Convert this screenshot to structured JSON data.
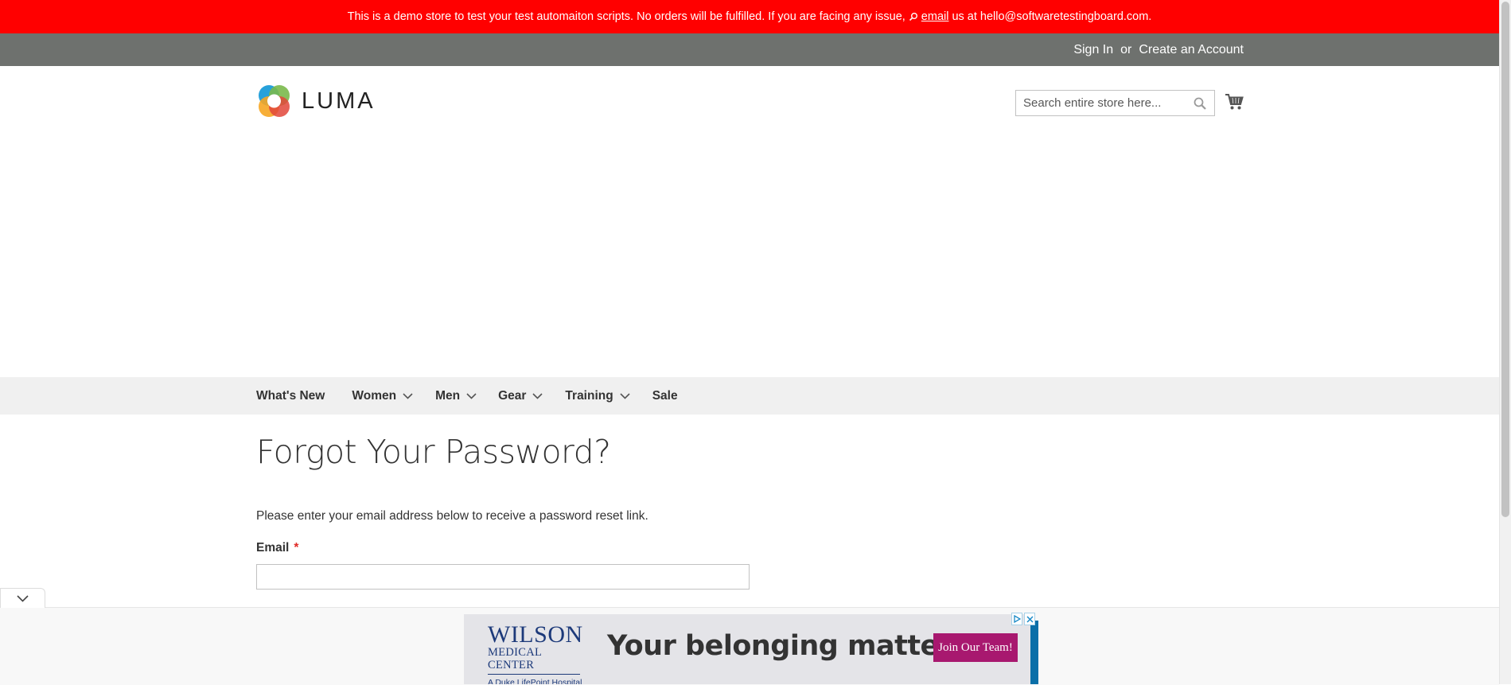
{
  "notice": {
    "text_before": "This is a demo store to test your test automaiton scripts. No orders will be fulfilled. If you are facing any issue,",
    "link": "email",
    "text_after": "us at hello@softwaretestingboard.com."
  },
  "top_links": {
    "sign_in": "Sign In",
    "separator": "or",
    "create_account": "Create an Account"
  },
  "logo": {
    "text": "LUMA"
  },
  "search": {
    "placeholder": "Search entire store here...",
    "value": ""
  },
  "nav": [
    {
      "label": "What's New",
      "has_submenu": false
    },
    {
      "label": "Women",
      "has_submenu": true
    },
    {
      "label": "Men",
      "has_submenu": true
    },
    {
      "label": "Gear",
      "has_submenu": true
    },
    {
      "label": "Training",
      "has_submenu": true
    },
    {
      "label": "Sale",
      "has_submenu": false
    }
  ],
  "main": {
    "title": "Forgot Your Password?",
    "description": "Please enter your email address below to receive a password reset link.",
    "email_label": "Email",
    "required_mark": "*",
    "email_value": ""
  },
  "ad": {
    "brand_line1": "WILSON",
    "brand_line2": "MEDICAL CENTER",
    "brand_line3": "A Duke LifePoint Hospital",
    "headline": "Your belonging matters.",
    "cta": "Join Our Team!"
  },
  "colors": {
    "notice_bg": "#ff0000",
    "topbar_bg": "#6e716e",
    "nav_bg": "#f0f0f0",
    "required": "#e02b27",
    "ad_cta": "#a8186f"
  },
  "icons": {
    "notice": "magnifier-icon",
    "search": "search-icon",
    "cart": "cart-icon",
    "nav_chevron": "chevron-down-icon",
    "collapse": "chevron-down-icon",
    "ad_choices": "ad-choices-icon",
    "ad_close": "close-icon"
  }
}
